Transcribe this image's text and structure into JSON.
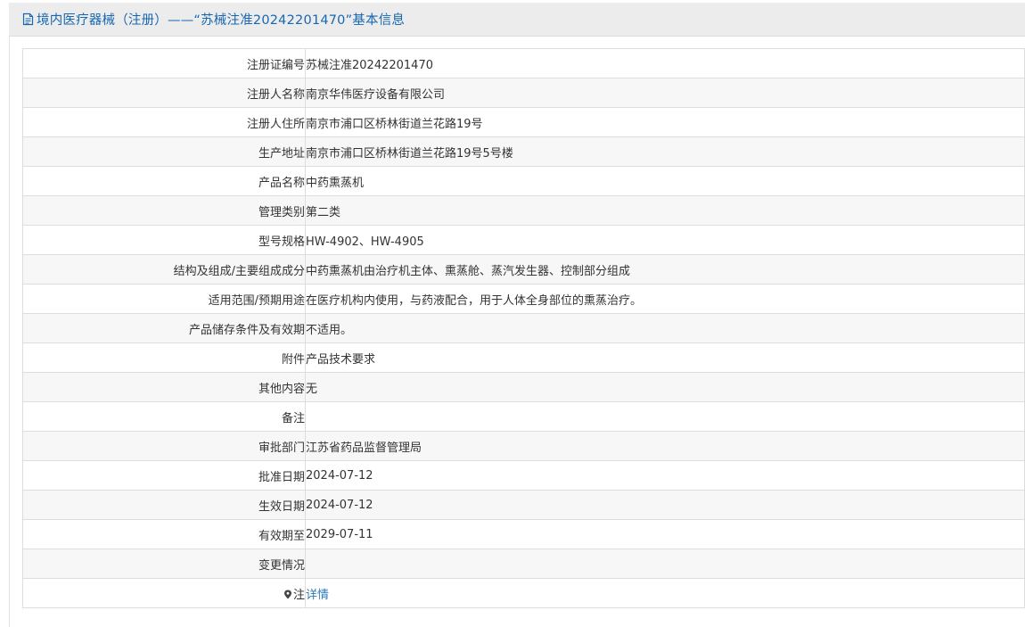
{
  "header": {
    "title": "境内医疗器械（注册）——“苏械注准20242201470”基本信息",
    "icon": "document-icon",
    "color": "#1767b2"
  },
  "rows": [
    {
      "label": "注册证编号",
      "value": "苏械注准20242201470"
    },
    {
      "label": "注册人名称",
      "value": "南京华伟医疗设备有限公司"
    },
    {
      "label": "注册人住所",
      "value": "南京市浦口区桥林街道兰花路19号"
    },
    {
      "label": "生产地址",
      "value": "南京市浦口区桥林街道兰花路19号5号楼"
    },
    {
      "label": "产品名称",
      "value": "中药熏蒸机"
    },
    {
      "label": "管理类别",
      "value": "第二类"
    },
    {
      "label": "型号规格",
      "value": "HW-4902、HW-4905"
    },
    {
      "label": "结构及组成/主要组成成分",
      "value": "中药熏蒸机由治疗机主体、熏蒸舱、蒸汽发生器、控制部分组成"
    },
    {
      "label": "适用范围/预期用途",
      "value": "在医疗机构内使用，与药液配合，用于人体全身部位的熏蒸治疗。"
    },
    {
      "label": "产品储存条件及有效期",
      "value": "不适用。"
    },
    {
      "label": "附件",
      "value": "产品技术要求"
    },
    {
      "label": "其他内容",
      "value": "无"
    },
    {
      "label": "备注",
      "value": ""
    },
    {
      "label": "审批部门",
      "value": "江苏省药品监督管理局"
    },
    {
      "label": "批准日期",
      "value": "2024-07-12"
    },
    {
      "label": "生效日期",
      "value": "2024-07-12"
    },
    {
      "label": "有效期至",
      "value": "2029-07-11"
    },
    {
      "label": "变更情况",
      "value": ""
    }
  ],
  "note_row": {
    "label": "注",
    "icon": "map-pin-icon",
    "link_text": "详情",
    "link_color": "#2a7ab8"
  }
}
